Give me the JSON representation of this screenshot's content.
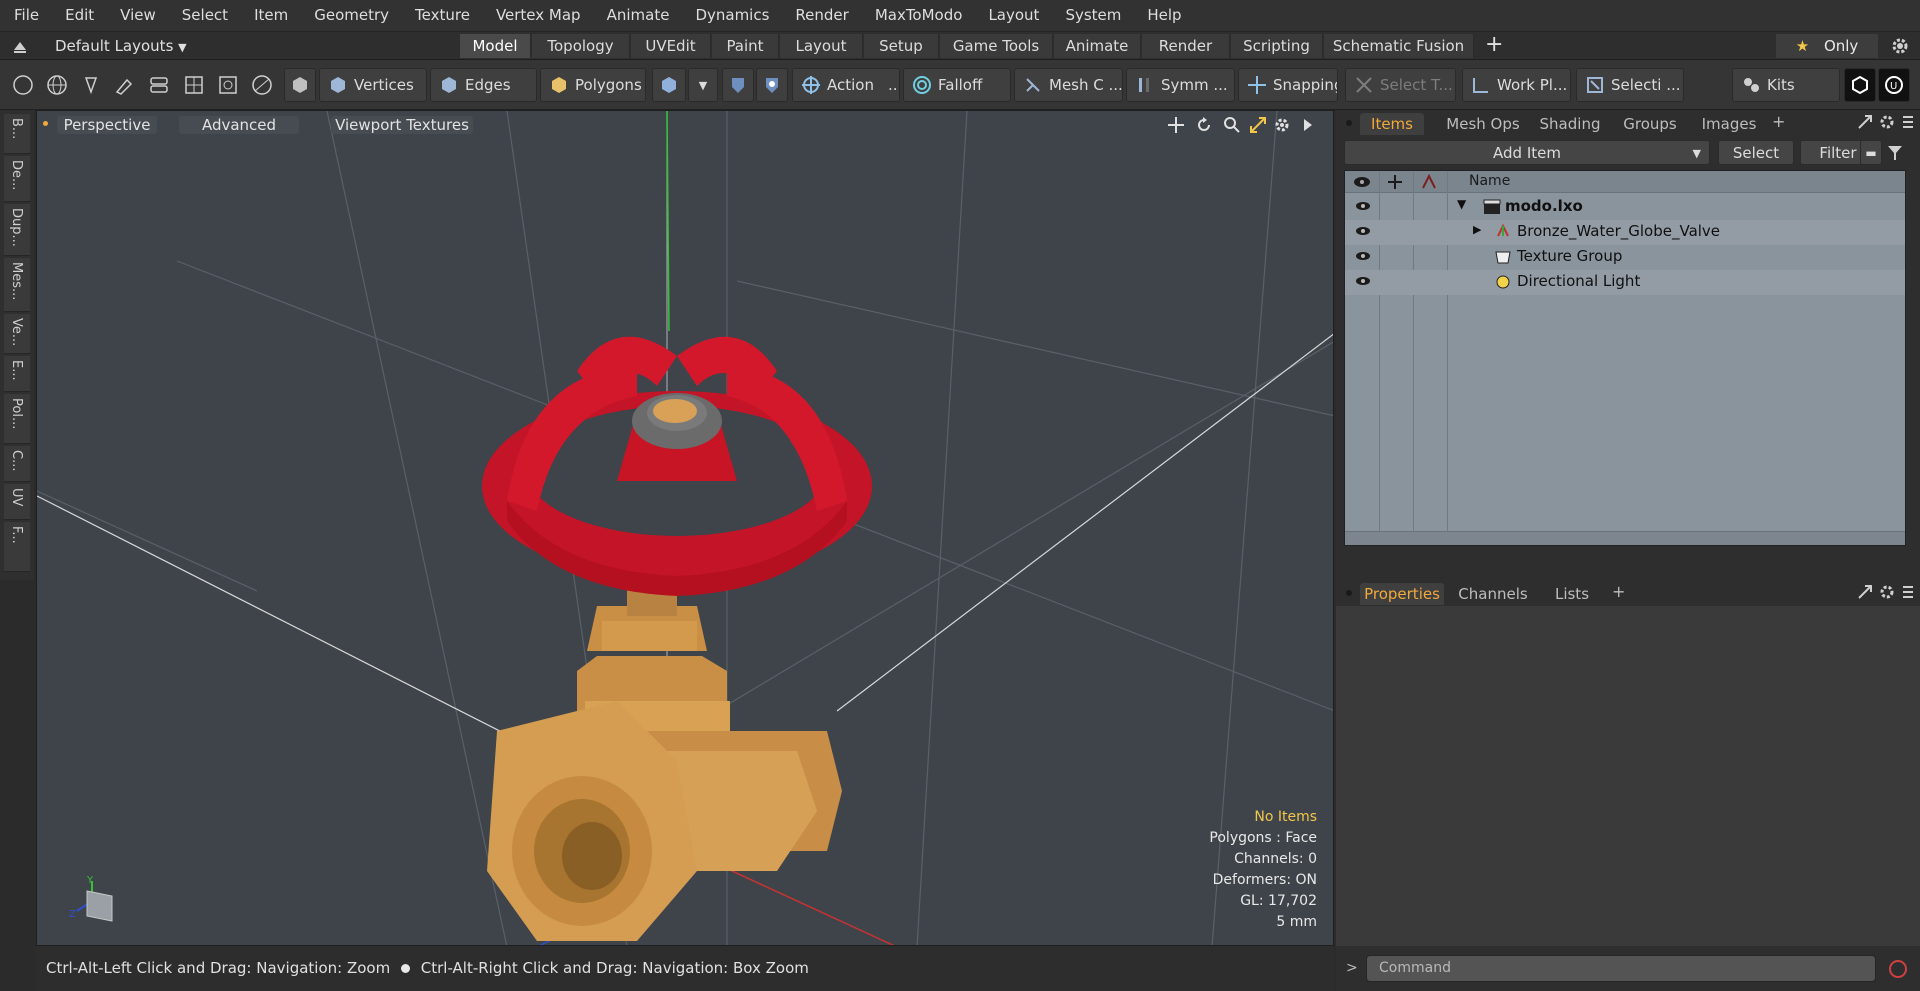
{
  "menu": [
    "File",
    "Edit",
    "View",
    "Select",
    "Item",
    "Geometry",
    "Texture",
    "Vertex Map",
    "Animate",
    "Dynamics",
    "Render",
    "MaxToModo",
    "Layout",
    "System",
    "Help"
  ],
  "layoutbar": {
    "layouts_label": "Default Layouts",
    "tabs": [
      "Model",
      "Topology",
      "UVEdit",
      "Paint",
      "Layout",
      "Setup",
      "Game Tools",
      "Animate",
      "Render",
      "Scripting",
      "Schematic Fusion"
    ],
    "active_tab": "Model",
    "add_tab": "+",
    "only_label": "Only"
  },
  "toolbar": {
    "vertices": "Vertices",
    "edges": "Edges",
    "polygons": "Polygons",
    "action": "Action",
    "action_more": "...",
    "falloff": "Falloff",
    "mesh_c": "Mesh C ...",
    "symm": "Symm ...",
    "snapping": "Snapping",
    "select_t": "Select T...",
    "work_pl": "Work Pl...",
    "selecti": "Selecti ...",
    "kits": "Kits"
  },
  "left_tabs": [
    "B...",
    "De...",
    "Dup...",
    "Mes...",
    "Ve...",
    "E...",
    "Pol...",
    "C...",
    "UV",
    "F..."
  ],
  "viewport": {
    "perspective": "Perspective",
    "advanced": "Advanced",
    "viewport_textures": "Viewport Textures",
    "hud": {
      "no_items": "No Items",
      "polygons": "Polygons : Face",
      "channels": "Channels: 0",
      "deformers": "Deformers: ON",
      "gl": "GL: 17,702",
      "scale": "5 mm"
    }
  },
  "statusbar": {
    "left": "Ctrl-Alt-Left Click and Drag: Navigation: Zoom",
    "right": "Ctrl-Alt-Right Click and Drag: Navigation: Box Zoom"
  },
  "items_panel": {
    "tabs": [
      "Items",
      "Mesh Ops",
      "Shading",
      "Groups",
      "Images"
    ],
    "active_tab": "Items",
    "add_item": "Add Item",
    "select": "Select",
    "filter": "Filter",
    "column_name": "Name",
    "rows": [
      {
        "label": "modo.lxo"
      },
      {
        "label": "Bronze_Water_Globe_Valve"
      },
      {
        "label": "Texture Group"
      },
      {
        "label": "Directional Light"
      }
    ]
  },
  "properties_panel": {
    "tabs": [
      "Properties",
      "Channels",
      "Lists"
    ],
    "active_tab": "Properties"
  },
  "command": {
    "placeholder": "Command",
    "prompt": ">"
  },
  "colors": {
    "accent": "#f2a93b",
    "viewport_bg": "#3e444a",
    "handle_red": "#d0162a",
    "brass": "#d39a4e"
  }
}
